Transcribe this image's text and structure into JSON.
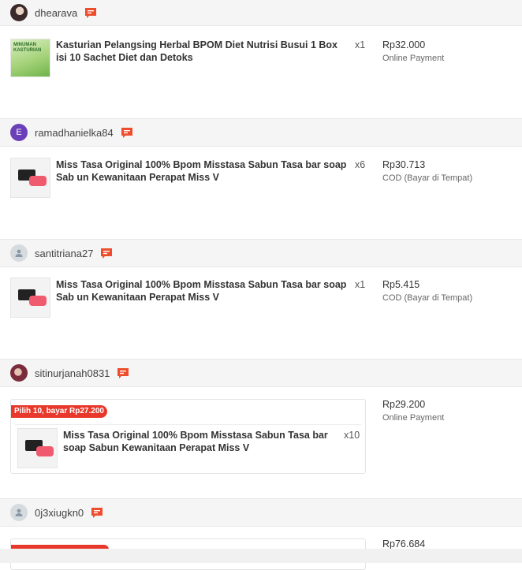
{
  "orders": [
    {
      "username": "dhearava",
      "avatar_icon": "user-photo-avatar",
      "product": "Kasturian Pelangsing Herbal BPOM Diet Nutrisi Busui 1 Box isi 10 Sachet Diet dan Detoks",
      "image_text": "MINUMAN KASTURIAN",
      "qty": "x1",
      "price": "Rp32.000",
      "payment": "Online Payment"
    },
    {
      "username": "ramadhanielka84",
      "avatar_letter": "E",
      "product": "Miss Tasa Original 100% Bpom Misstasa Sabun Tasa bar soap Sab un Kewanitaan Perapat Miss V",
      "qty": "x6",
      "price": "Rp30.713",
      "payment": "COD (Bayar di Tempat)"
    },
    {
      "username": "santitriana27",
      "avatar_icon": "default-user-avatar",
      "product": "Miss Tasa Original 100% Bpom Misstasa Sabun Tasa bar soap Sab un Kewanitaan Perapat Miss V",
      "qty": "x1",
      "price": "Rp5.415",
      "payment": "COD (Bayar di Tempat)"
    },
    {
      "username": "sitinurjanah0831",
      "avatar_icon": "user-photo-avatar",
      "bundle_tag": "Pilih 10, bayar Rp27.200",
      "product": "Miss Tasa Original 100% Bpom Misstasa Sabun Tasa bar soap Sabun Kewanitaan Perapat Miss V",
      "qty": "x10",
      "price": "Rp29.200",
      "payment": "Online Payment"
    },
    {
      "username": "0j3xiugkn0",
      "avatar_icon": "default-user-avatar",
      "price": "Rp76.684"
    }
  ],
  "icons": {
    "chat": "chat-bubble-icon",
    "chat_color": "#ee4d2d"
  }
}
